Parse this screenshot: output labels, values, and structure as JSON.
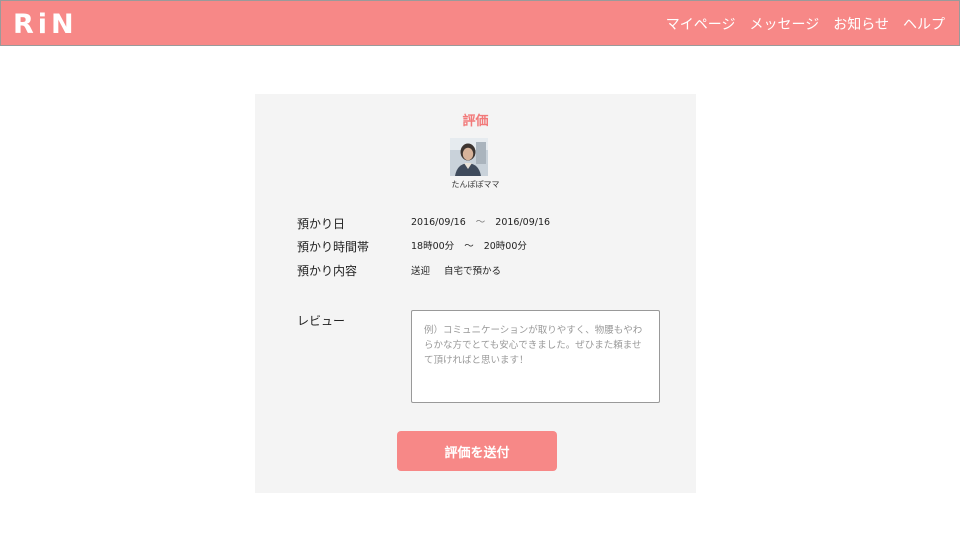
{
  "header": {
    "logo": "RiN",
    "nav": [
      "マイページ",
      "メッセージ",
      "お知らせ",
      "ヘルプ"
    ],
    "brand_color": "#f78887"
  },
  "card": {
    "title": "評価",
    "user_name": "たんぽぽママ",
    "rows": [
      {
        "label": "預かり日",
        "from": "2016/09/16",
        "separator": "〜",
        "to": "2016/09/16"
      },
      {
        "label": "預かり時間帯",
        "from": "18時00分",
        "separator": "〜",
        "to": "20時00分"
      },
      {
        "label": "預かり内容",
        "item1": "送迎",
        "item2": "自宅で預かる"
      }
    ],
    "review_label": "レビュー",
    "review_placeholder": "例）コミュニケーションが取りやすく、物腰もやわらかな方でとても安心できました。ぜひまた頼ませて頂ければと思います！",
    "submit_label": "評価を送付",
    "background": "#f4f4f4"
  }
}
